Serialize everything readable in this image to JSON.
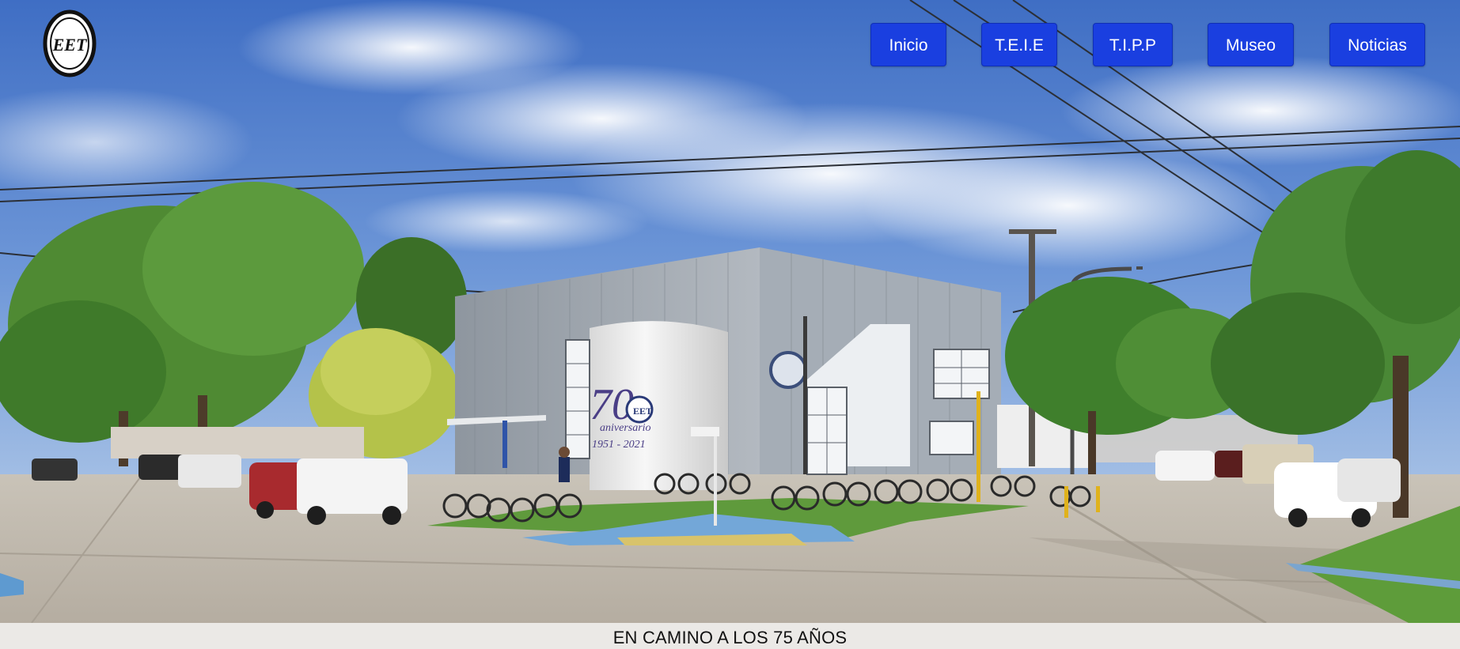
{
  "brand": {
    "logo_text": "EET"
  },
  "nav": {
    "items": [
      {
        "label": "Inicio"
      },
      {
        "label": "T.E.I.E"
      },
      {
        "label": "T.I.P.P"
      },
      {
        "label": "Museo"
      },
      {
        "label": "Noticias"
      }
    ]
  },
  "hero": {
    "building_sign_number": "70",
    "building_sign_word": "aniversario",
    "building_sign_years": "1951 - 2021",
    "building_logo_text": "EET"
  },
  "banner": {
    "text": "EN CAMINO A LOS 75 AÑOS"
  },
  "colors": {
    "nav_button": "#1a3fe0",
    "banner_bg": "#ebe9e6",
    "sky": "#4f7fd0"
  }
}
